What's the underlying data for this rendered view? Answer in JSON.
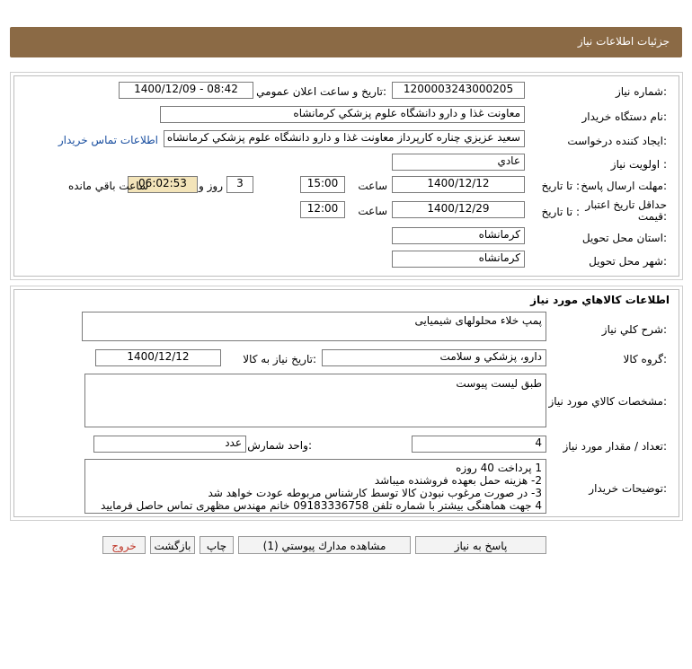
{
  "header": {
    "title": "جزئيات اطلاعات نياز"
  },
  "info": {
    "need_number_label": "شماره نياز:",
    "need_number": "1200003243000205",
    "announce_label": "تاريخ و ساعت اعلان عمومي:",
    "announce_value": "1400/12/09 - 08:42",
    "buyer_label": "نام دستگاه خريدار:",
    "buyer_value": "معاونت غذا و دارو دانشگاه علوم پزشكي كرمانشاه",
    "creator_label": "ايجاد كننده درخواست:",
    "creator_value": "سعيد عزيزي چناره كارپرداز معاونت غذا و دارو دانشگاه علوم پزشكي كرمانشاه",
    "contact_link": "اطلاعات تماس خريدار",
    "priority_label": "اولويت نياز :",
    "priority_value": "عادي",
    "deadline_label": "مهلت ارسال پاسخ:",
    "to_date_label": "تا تاريخ :",
    "deadline_date": "1400/12/12",
    "time_label": "ساعت",
    "deadline_time": "15:00",
    "days_value": "3",
    "days_label": "روز و",
    "remaining_time": "06:02:53",
    "remaining_label": "ساعت باقي مانده",
    "validity_label": "حداقل تاريخ اعتبار قيمت:",
    "validity_date": "1400/12/29",
    "validity_time": "12:00",
    "province_label": "استان محل تحويل:",
    "province_value": "كرمانشاه",
    "city_label": "شهر محل تحويل:",
    "city_value": "كرمانشاه"
  },
  "goods": {
    "section_title": "اطلاعات كالاهاي مورد نياز",
    "desc_label": "شرح كلي نياز:",
    "desc_value": "پمپ خلاء محلولهای شیمیایی",
    "group_label": "گروه كالا:",
    "group_value": "دارو، پزشكي و سلامت",
    "need_date_label": "تاريخ نياز به كالا:",
    "need_date_value": "1400/12/12",
    "specs_label": "مشخصات كالاي مورد نياز:",
    "specs_value": "طبق لیست پیوست",
    "qty_label": "تعداد / مقدار مورد نياز:",
    "qty_value": "4",
    "unit_label": "واحد شمارش:",
    "unit_value": "عدد",
    "notes_label": "توضيحات خريدار:",
    "notes_lines": [
      "1 پرداخت 40 روزه",
      "2- هزینه حمل بعهده فروشنده میباشد",
      "3- در صورت مرغوب نبودن کالا توسط کارشناس مربوطه عودت خواهد شد",
      "4 جهت هماهنگی بیشتر با شماره تلفن 09183336758 خانم مهندس مظهری تماس حاصل فرمایید"
    ]
  },
  "buttons": {
    "reply": "پاسخ به نياز",
    "attachments": "مشاهده مدارك پيوستي (1)",
    "print": "چاپ",
    "back": "بازگشت",
    "exit": "خروج"
  },
  "colors": {
    "header": "#8b6a45",
    "remaining_bg": "#f3e4b9",
    "link": "#1a4fa0",
    "exit_text": "#c0392b"
  }
}
